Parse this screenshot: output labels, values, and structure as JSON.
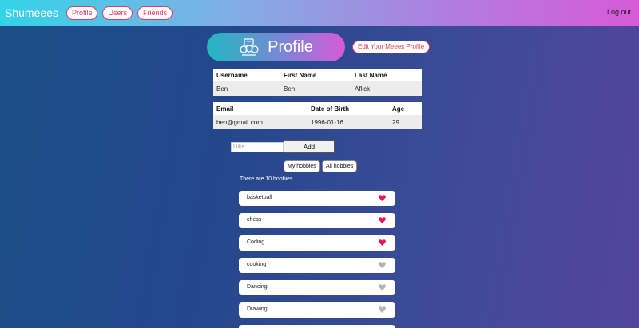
{
  "nav": {
    "brand": "Shumeees",
    "links": [
      "Profile",
      "Users",
      "Friends"
    ],
    "logout": "Log out"
  },
  "profile": {
    "title": "Profile",
    "edit_label": "Edit Your Meees Profile"
  },
  "user_table": {
    "headers": [
      "Username",
      "First Name",
      "Last Name"
    ],
    "values": [
      "Ben",
      "Ben",
      "Aflick"
    ]
  },
  "contact_table": {
    "headers": [
      "Email",
      "Date of Birth",
      "Age"
    ],
    "values": [
      "ben@gmail.com",
      "1996-01-16",
      "29"
    ]
  },
  "hobby_form": {
    "placeholder": "I like...",
    "add_label": "Add"
  },
  "filters": {
    "my_hobbies": "My hobbies",
    "all_hobbies": "All hobbies"
  },
  "hobby_count": "There are 10 hobbies",
  "hobbies": [
    {
      "name": "basketball",
      "liked": true
    },
    {
      "name": "chess",
      "liked": true
    },
    {
      "name": "Coding",
      "liked": true
    },
    {
      "name": "cooking",
      "liked": false
    },
    {
      "name": "Dancing",
      "liked": false
    },
    {
      "name": "Drawing",
      "liked": false
    }
  ],
  "colors": {
    "liked_heart": "#e8145e",
    "unliked_heart": "#b3b3b3"
  }
}
